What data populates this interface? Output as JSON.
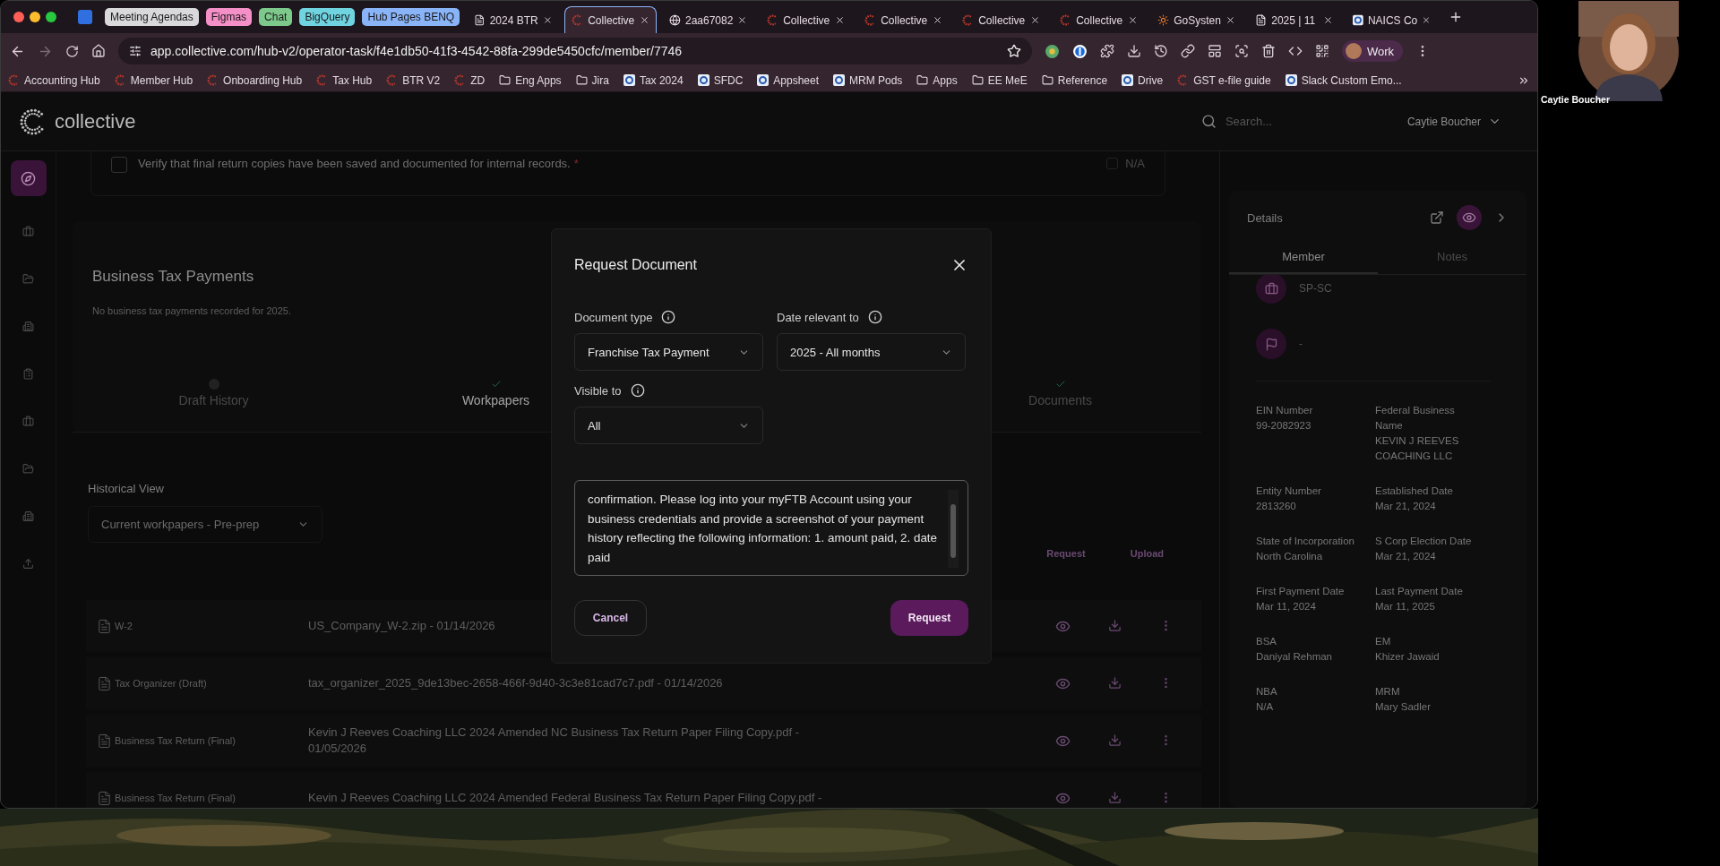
{
  "browser": {
    "tab_groups": [
      {
        "label": "Meeting Agendas",
        "color": "#d9d9dc"
      },
      {
        "label": "Figmas",
        "color": "#f48fc7"
      },
      {
        "label": "Chat",
        "color": "#7dc98b"
      },
      {
        "label": "BigQuery",
        "color": "#6fd3e0"
      },
      {
        "label": "Hub Pages BENQ",
        "color": "#8ab4f8"
      }
    ],
    "tabs": [
      {
        "label": "2024 BTR",
        "kind": "doc",
        "selected": false
      },
      {
        "label": "Collective",
        "kind": "collective",
        "selected": true
      },
      {
        "label": "2aa67082",
        "kind": "globe",
        "selected": false
      },
      {
        "label": "Collective",
        "kind": "collective",
        "selected": false
      },
      {
        "label": "Collective",
        "kind": "collective",
        "selected": false
      },
      {
        "label": "Collective",
        "kind": "collective",
        "selected": false
      },
      {
        "label": "Collective",
        "kind": "collective",
        "selected": false
      },
      {
        "label": "GoSysten",
        "kind": "sun",
        "selected": false
      },
      {
        "label": "2025 | 11",
        "kind": "doc",
        "selected": false
      },
      {
        "label": "NAICS Co",
        "kind": "site",
        "selected": false
      }
    ],
    "url": "app.collective.com/hub-v2/operator-task/f4e1db50-41f3-4542-88fa-299de5450cfc/member/7746",
    "profile": "Work",
    "bookmarks": [
      {
        "label": "Accounting Hub",
        "kind": "collective"
      },
      {
        "label": "Member Hub",
        "kind": "collective"
      },
      {
        "label": "Onboarding Hub",
        "kind": "collective"
      },
      {
        "label": "Tax Hub",
        "kind": "collective"
      },
      {
        "label": "BTR V2",
        "kind": "collective"
      },
      {
        "label": "ZD",
        "kind": "collective"
      },
      {
        "label": "Eng Apps",
        "kind": "folder"
      },
      {
        "label": "Jira",
        "kind": "folder"
      },
      {
        "label": "Tax 2024",
        "kind": "site"
      },
      {
        "label": "SFDC",
        "kind": "site"
      },
      {
        "label": "Appsheet",
        "kind": "site"
      },
      {
        "label": "MRM Pods",
        "kind": "site"
      },
      {
        "label": "Apps",
        "kind": "folder"
      },
      {
        "label": "EE MeE",
        "kind": "folder"
      },
      {
        "label": "Reference",
        "kind": "folder"
      },
      {
        "label": "Drive",
        "kind": "site"
      },
      {
        "label": "GST e-file guide",
        "kind": "collective"
      },
      {
        "label": "Slack Custom Emo...",
        "kind": "site"
      }
    ]
  },
  "app": {
    "brand": "collective",
    "search": {
      "placeholder": "Search..."
    },
    "user": "Caytie Boucher",
    "sidebar": {
      "items": [
        {
          "selected": true
        },
        {
          "selected": false
        },
        {
          "selected": false
        },
        {
          "selected": false
        },
        {
          "selected": false
        },
        {
          "selected": false
        },
        {
          "selected": false
        },
        {
          "selected": false
        },
        {
          "selected": false
        }
      ]
    },
    "checklist": {
      "text": "Verify that final return copies have been saved and documented for internal records.",
      "required_mark": "*",
      "checked": false,
      "na_label": "N/A",
      "na_checked": false
    },
    "payments": {
      "title": "Business Tax Payments",
      "empty_text": "No business tax payments recorded for 2025."
    },
    "steps": [
      {
        "label": "Draft History",
        "completed": false,
        "selected": false
      },
      {
        "label": "Workpapers",
        "completed": true,
        "selected": true
      },
      {
        "label": "Documents",
        "completed": true,
        "selected": false
      }
    ],
    "historical_view": {
      "label": "Historical View",
      "value": "Current workpapers - Pre-prep"
    },
    "table": {
      "actions": [
        "Request",
        "Upload"
      ],
      "rows": [
        {
          "type": "W-2",
          "file": "US_Company_W-2.zip - 01/14/2026"
        },
        {
          "type": "Tax Organizer (Draft)",
          "file": "tax_organizer_2025_9de13bec-2658-466f-9d40-3c3e81cad7c7.pdf - 01/14/2026"
        },
        {
          "type": "Business Tax Return (Final)",
          "file": "Kevin J Reeves Coaching LLC 2024 Amended NC Business Tax Return Paper Filing Copy.pdf - 01/05/2026"
        },
        {
          "type": "Business Tax Return (Final)",
          "file": "Kevin J Reeves Coaching LLC 2024 Amended Federal Business Tax Return Paper Filing Copy.pdf -"
        }
      ]
    },
    "details": {
      "title": "Details",
      "tabs": [
        {
          "label": "Member",
          "selected": true
        },
        {
          "label": "Notes",
          "selected": false
        }
      ],
      "items": [
        {
          "text": "SP-SC"
        },
        {
          "text": "-"
        }
      ],
      "fields": [
        {
          "label": "EIN Number",
          "value": "99-2082923"
        },
        {
          "label": "Federal Business Name",
          "value": "KEVIN J REEVES COACHING LLC"
        },
        {
          "label": "Entity Number",
          "value": "2813260"
        },
        {
          "label": "Established Date",
          "value": "Mar 21, 2024"
        },
        {
          "label": "State of Incorporation",
          "value": "North Carolina"
        },
        {
          "label": "S Corp Election Date",
          "value": "Mar 21, 2024"
        },
        {
          "label": "First Payment Date",
          "value": "Mar 11, 2024"
        },
        {
          "label": "Last Payment Date",
          "value": "Mar 11, 2025"
        },
        {
          "label": "BSA",
          "value": "Daniyal Rehman"
        },
        {
          "label": "EM",
          "value": "Khizer Jawaid"
        },
        {
          "label": "NBA",
          "value": "N/A"
        },
        {
          "label": "MRM",
          "value": "Mary Sadler"
        }
      ]
    }
  },
  "modal": {
    "title": "Request Document",
    "fields": [
      {
        "label": "Document type",
        "value": "Franchise Tax Payment"
      },
      {
        "label": "Date relevant to",
        "value": "2025 - All months"
      },
      {
        "label": "Visible to",
        "value": "All"
      }
    ],
    "message": "confirmation. Please log into your myFTB Account using your business credentials and provide a screenshot of your payment history reflecting the following information: 1. amount paid, 2. date paid",
    "cancel": "Cancel",
    "submit": "Request"
  },
  "webcam": {
    "name": "Caytie Boucher"
  }
}
